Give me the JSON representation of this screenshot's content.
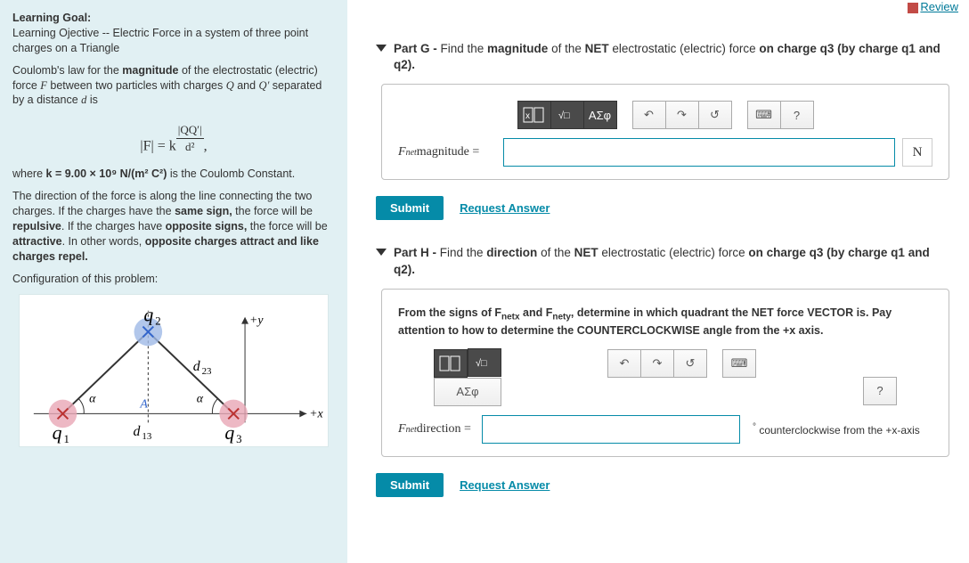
{
  "review_label": "Review",
  "sidebar": {
    "lg_head": "Learning Goal:",
    "lg_body": "Learning Ojective -- Electric Force in a system of three point charges on a Triangle",
    "coulomb_intro_pre": "Coulomb's law for the ",
    "coulomb_intro_bold": "magnitude",
    "coulomb_intro_mid": " of the electrostatic (electric) force ",
    "coulomb_F": "F",
    "coulomb_between": " between two particles with charges ",
    "coulomb_Q": "Q",
    "coulomb_and": " and ",
    "coulomb_Qp": "Q′",
    "coulomb_sep": " separated by a distance ",
    "coulomb_d": "d",
    "coulomb_is": " is",
    "formula_lhs": "|F| = k",
    "formula_top": "|QQ′|",
    "formula_bot": "d²",
    "formula_comma": ",",
    "k_line_pre": "where  ",
    "k_line_bold": "k = 9.00 × 10⁹ N/(m² C²)",
    "k_line_post": "  is the Coulomb Constant.",
    "dir_para": "The direction of the force is along the line connecting the two charges. If the charges have the ",
    "same_sign": "same sign,",
    "dir_mid1": " the force will be ",
    "repulsive": "repulsive",
    "dir_mid2": ". If the charges have ",
    "opp_signs": "opposite signs,",
    "dir_mid3": " the force will be ",
    "attractive": "attractive",
    "dir_end": ". In other words, ",
    "dir_summary": "opposite charges attract and like charges repel.",
    "config_label": "Configuration of this problem:"
  },
  "partG": {
    "label": "Part G - ",
    "text_pre": "Find the ",
    "b1": "magnitude",
    "text_mid1": " of the ",
    "b2": "NET",
    "text_mid2": " electrostatic (electric) force ",
    "b3": "on charge q3 (by charge q1 and q2).",
    "answer_prefix": "F",
    "answer_sub": "net",
    "answer_word": "magnitude =",
    "unit": "N",
    "sigma": "ΑΣφ",
    "question": "?",
    "submit": "Submit",
    "request": "Request Answer"
  },
  "partH": {
    "label": "Part H - ",
    "text_pre": "Find the ",
    "b1": "direction",
    "text_mid1": " of the ",
    "b2": "NET",
    "text_mid2": " electrostatic (electric) force ",
    "b3": "on charge q3 (by charge q1 and q2).",
    "hint_p1": "From the signs of F",
    "hint_s1": "netx",
    "hint_p2": " and F",
    "hint_s2": "nety",
    "hint_p3": ", determine in which quadrant the NET force VECTOR is. Pay attention to how to determine the COUNTERCLOCKWISE angle from the +x axis.",
    "answer_prefix": "F",
    "answer_sub": "net",
    "answer_word": "direction =",
    "tail_deg": "°",
    "tail_text": " counterclockwise from the +x-axis",
    "sigma": "ΑΣφ",
    "question": "?",
    "submit": "Submit",
    "request": "Request Answer"
  }
}
